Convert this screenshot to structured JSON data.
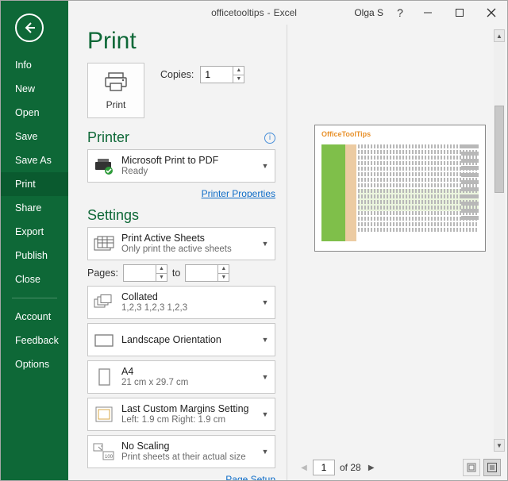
{
  "window": {
    "doc": "officetooltips",
    "app": "Excel",
    "user": "Olga S"
  },
  "sidebar": {
    "items": [
      "Info",
      "New",
      "Open",
      "Save",
      "Save As",
      "Print",
      "Share",
      "Export",
      "Publish",
      "Close"
    ],
    "active_index": 5,
    "footer_items": [
      "Account",
      "Feedback",
      "Options"
    ]
  },
  "print": {
    "title": "Print",
    "button": "Print",
    "copies_label": "Copies:",
    "copies_value": "1"
  },
  "printer": {
    "heading": "Printer",
    "name": "Microsoft Print to PDF",
    "status": "Ready",
    "properties_link": "Printer Properties"
  },
  "settings": {
    "heading": "Settings",
    "print_what": {
      "title": "Print Active Sheets",
      "sub": "Only print the active sheets"
    },
    "pages_label": "Pages:",
    "pages_to": "to",
    "collate": {
      "title": "Collated",
      "sub": "1,2,3    1,2,3    1,2,3"
    },
    "orientation": {
      "title": "Landscape Orientation",
      "sub": ""
    },
    "paper": {
      "title": "A4",
      "sub": "21 cm x 29.7 cm"
    },
    "margins": {
      "title": "Last Custom Margins Setting",
      "sub": "Left:  1.9 cm    Right:  1.9 cm"
    },
    "scaling": {
      "title": "No Scaling",
      "sub": "Print sheets at their actual size"
    },
    "page_setup_link": "Page Setup"
  },
  "preview": {
    "doc_title": "OfficeToolTips",
    "page_current": "1",
    "of_label": "of 28"
  }
}
